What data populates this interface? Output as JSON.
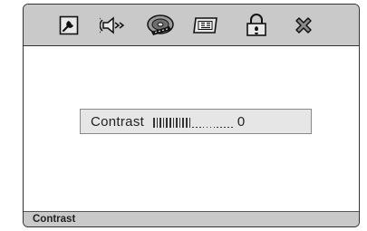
{
  "toolbar": {
    "icons": [
      "settings-wrench-icon",
      "speaker-audio-icon",
      "disc-video-icon",
      "display-screen-icon",
      "lock-icon",
      "close-icon"
    ]
  },
  "contrast": {
    "label": "Contrast",
    "value": "0",
    "level": 0.5,
    "total_steps": 24
  },
  "status": {
    "label": "Contrast"
  }
}
